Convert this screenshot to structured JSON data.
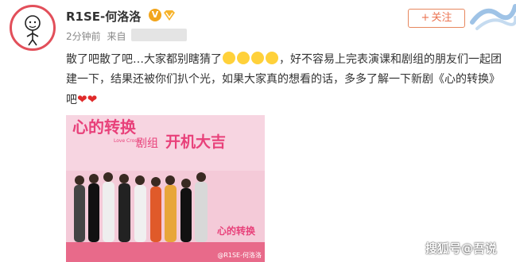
{
  "post": {
    "username": "R1SE-何洛洛",
    "verified_mark": "V",
    "time": "2分钟前",
    "source_prefix": "来自",
    "follow_plus": "+",
    "follow_label": "关注",
    "text_part1": "散了吧散了吧…大家都别瞎猜了",
    "text_part2": "，好不容易上完表演课和剧组的朋友们一起团建一下，结果还被你们扒个光，如果大家真的想看的话，多多了解一下新剧《心的转换》吧"
  },
  "photo": {
    "banner_logo_text": "心的转换",
    "banner_logo_en": "Love Cross",
    "banner_subtitle": "剧组",
    "banner_headline": "开机大吉",
    "corner_logo": "心的转换",
    "caption": "@R1SE-何洛洛"
  },
  "watermark": "搜狐号@吾说",
  "colors": {
    "accent_orange": "#eb7350",
    "avatar_ring": "#e24f5a",
    "banner_pink": "#f4cad8",
    "heart": "#e02a2a"
  },
  "icons": {
    "verified": "v-badge-icon",
    "vip": "vip-badge-icon",
    "emoji": "laugh-cry-emoji-icon",
    "heart": "heart-icon"
  }
}
